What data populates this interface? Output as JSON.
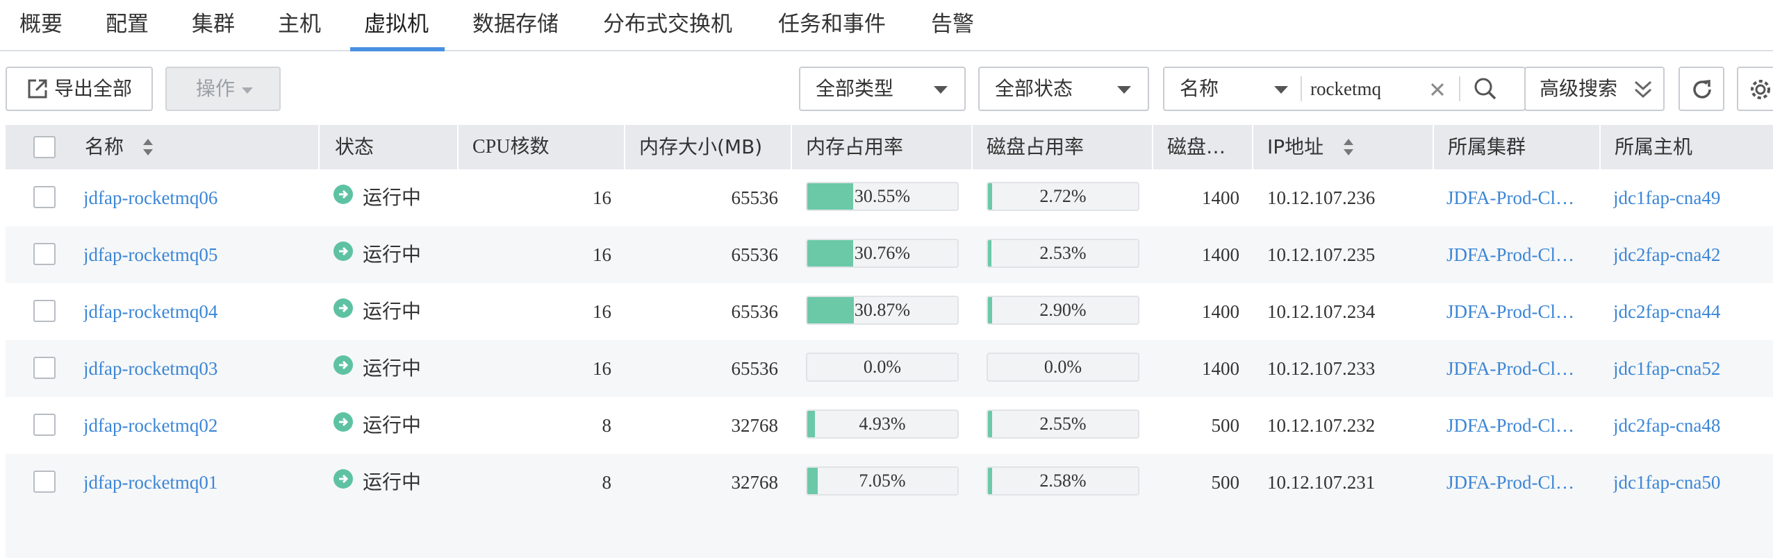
{
  "tabs": [
    {
      "label": "概要",
      "active": false
    },
    {
      "label": "配置",
      "active": false
    },
    {
      "label": "集群",
      "active": false
    },
    {
      "label": "主机",
      "active": false
    },
    {
      "label": "虚拟机",
      "active": true
    },
    {
      "label": "数据存储",
      "active": false
    },
    {
      "label": "分布式交换机",
      "active": false
    },
    {
      "label": "任务和事件",
      "active": false
    },
    {
      "label": "告警",
      "active": false
    }
  ],
  "toolbar": {
    "export_label": "导出全部",
    "action_label": "操作",
    "type_filter": "全部类型",
    "status_filter": "全部状态",
    "search_field": "名称",
    "search_value": "rocketmq",
    "advanced_search": "高级搜索"
  },
  "columns": {
    "name": "名称",
    "status": "状态",
    "cpu": "CPU核数",
    "memory": "内存大小(MB)",
    "mem_usage": "内存占用率",
    "disk_usage": "磁盘占用率",
    "disk": "磁盘…",
    "ip": "IP地址",
    "cluster": "所属集群",
    "host": "所属主机"
  },
  "rows": [
    {
      "name": "jdfap-rocketmq06",
      "status": "运行中",
      "cpu": "16",
      "memory": "65536",
      "mem_usage": "30.55%",
      "mem_fill": 0.3055,
      "disk_usage": "2.72%",
      "disk_fill": 0.0272,
      "disk": "1400",
      "ip": "10.12.107.236",
      "cluster": "JDFA-Prod-Cl…",
      "host": "jdc1fap-cna49"
    },
    {
      "name": "jdfap-rocketmq05",
      "status": "运行中",
      "cpu": "16",
      "memory": "65536",
      "mem_usage": "30.76%",
      "mem_fill": 0.3076,
      "disk_usage": "2.53%",
      "disk_fill": 0.0253,
      "disk": "1400",
      "ip": "10.12.107.235",
      "cluster": "JDFA-Prod-Cl…",
      "host": "jdc2fap-cna42"
    },
    {
      "name": "jdfap-rocketmq04",
      "status": "运行中",
      "cpu": "16",
      "memory": "65536",
      "mem_usage": "30.87%",
      "mem_fill": 0.3087,
      "disk_usage": "2.90%",
      "disk_fill": 0.029,
      "disk": "1400",
      "ip": "10.12.107.234",
      "cluster": "JDFA-Prod-Cl…",
      "host": "jdc2fap-cna44"
    },
    {
      "name": "jdfap-rocketmq03",
      "status": "运行中",
      "cpu": "16",
      "memory": "65536",
      "mem_usage": "0.0%",
      "mem_fill": 0,
      "disk_usage": "0.0%",
      "disk_fill": 0,
      "disk": "1400",
      "ip": "10.12.107.233",
      "cluster": "JDFA-Prod-Cl…",
      "host": "jdc1fap-cna52"
    },
    {
      "name": "jdfap-rocketmq02",
      "status": "运行中",
      "cpu": "8",
      "memory": "32768",
      "mem_usage": "4.93%",
      "mem_fill": 0.0493,
      "disk_usage": "2.55%",
      "disk_fill": 0.0255,
      "disk": "500",
      "ip": "10.12.107.232",
      "cluster": "JDFA-Prod-Cl…",
      "host": "jdc2fap-cna48"
    },
    {
      "name": "jdfap-rocketmq01",
      "status": "运行中",
      "cpu": "8",
      "memory": "32768",
      "mem_usage": "7.05%",
      "mem_fill": 0.0705,
      "disk_usage": "2.58%",
      "disk_fill": 0.0258,
      "disk": "500",
      "ip": "10.12.107.231",
      "cluster": "JDFA-Prod-Cl…",
      "host": "jdc1fap-cna50"
    }
  ],
  "colors": {
    "accent": "#4a90e2",
    "link": "#3b86d6",
    "running": "#5ec2a2",
    "usage_fill": "#6bc9a8"
  }
}
